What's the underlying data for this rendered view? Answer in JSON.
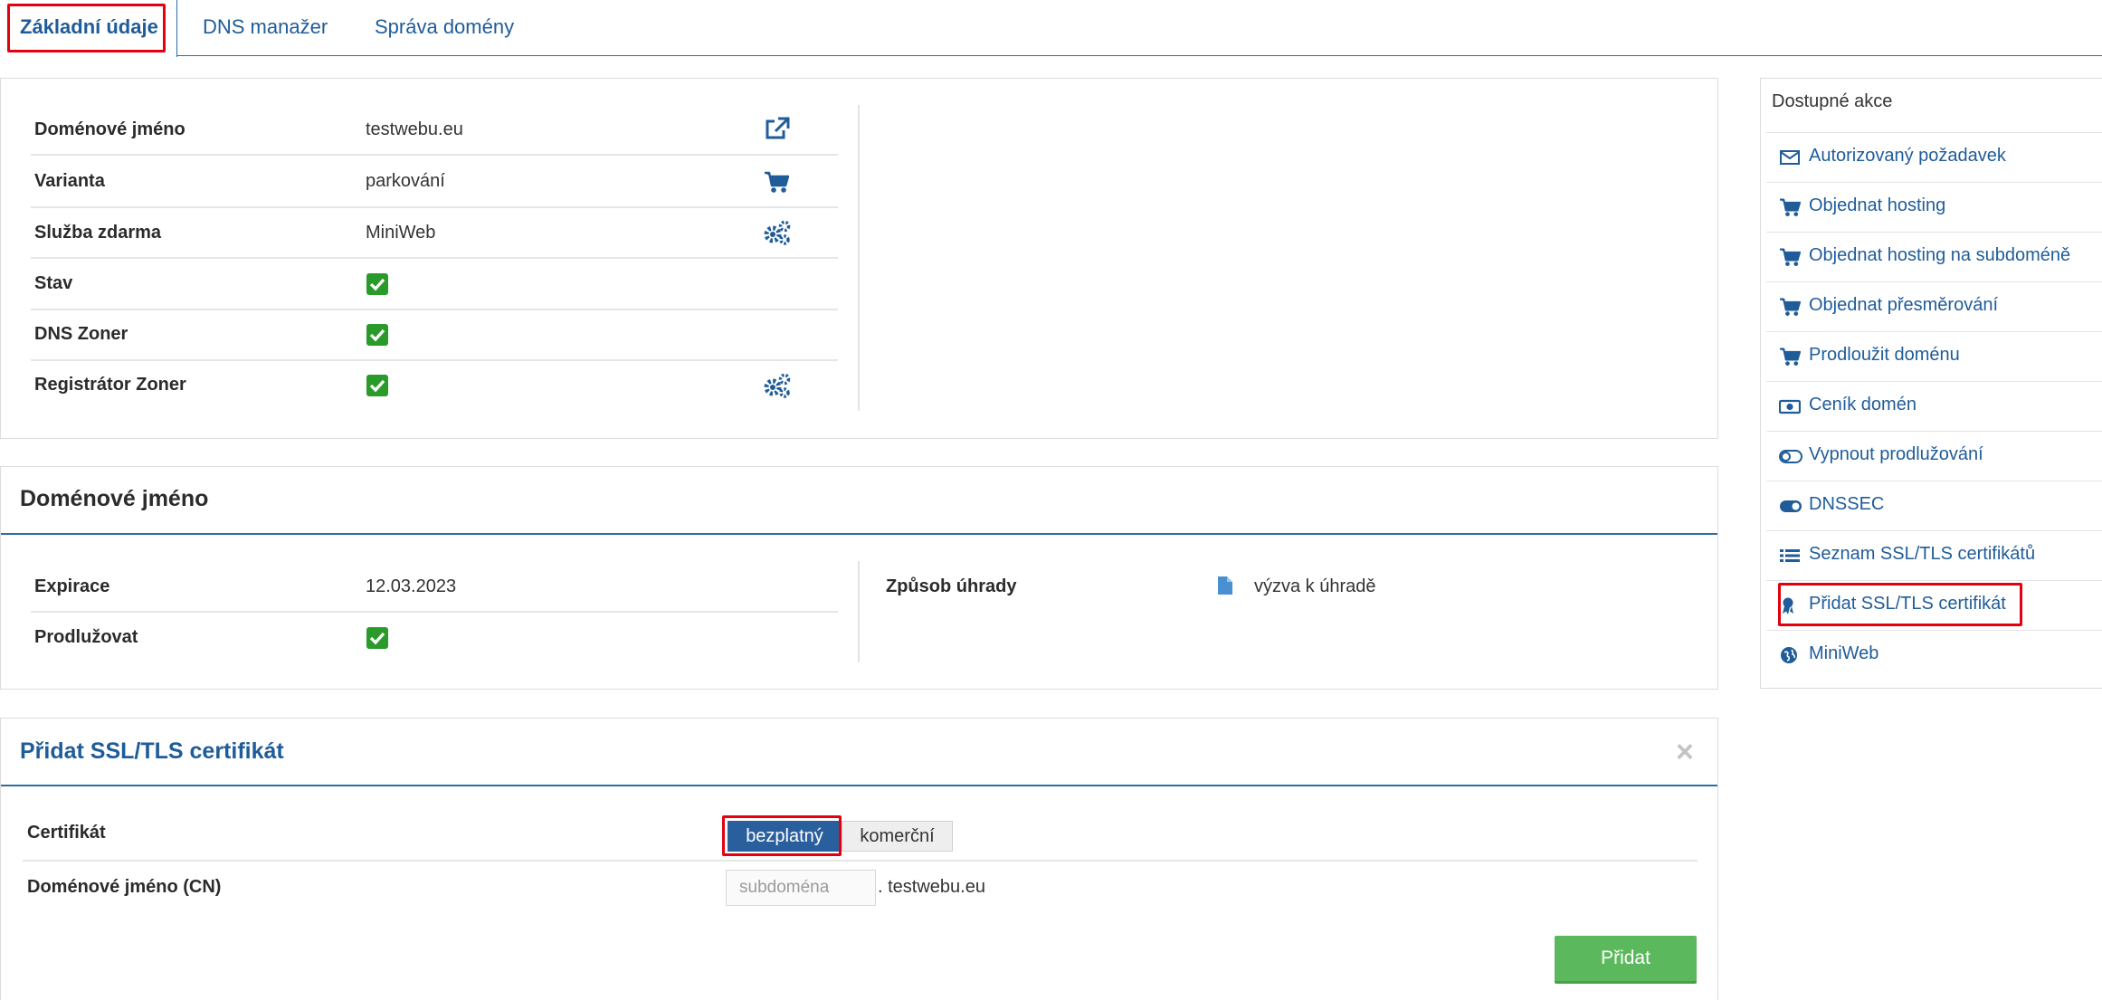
{
  "tabs": [
    {
      "label": "Základní údaje",
      "active": true
    },
    {
      "label": "DNS manažer",
      "active": false
    },
    {
      "label": "Správa domény",
      "active": false
    }
  ],
  "basic": {
    "rows": [
      {
        "label": "Doménové jméno",
        "value": "testwebu.eu",
        "icon": "external-link-icon"
      },
      {
        "label": "Varianta",
        "value": "parkování",
        "icon": "cart-icon"
      },
      {
        "label": "Služba zdarma",
        "value": "MiniWeb",
        "icon": "gears-icon"
      },
      {
        "label": "Stav",
        "value": "",
        "icon": ""
      },
      {
        "label": "DNS Zoner",
        "value": "",
        "icon": ""
      },
      {
        "label": "Registrátor Zoner",
        "value": "",
        "icon": "gears-icon"
      }
    ]
  },
  "domain_panel": {
    "title": "Doménové jméno",
    "expiry_label": "Expirace",
    "expiry_value": "12.03.2023",
    "renew_label": "Prodlužovat",
    "payment_label": "Způsob úhrady",
    "payment_value": "výzva k úhradě"
  },
  "ssl_panel": {
    "title": "Přidat SSL/TLS certifikát",
    "close_symbol": "×",
    "cert_label": "Certifikát",
    "cert_options": [
      "bezplatný",
      "komerční"
    ],
    "cert_selected": "bezplatný",
    "cn_label": "Doménové jméno (CN)",
    "cn_placeholder": "subdoména",
    "cn_suffix": ". testwebu.eu",
    "submit_label": "Přidat"
  },
  "sidebar": {
    "title": "Dostupné akce",
    "items": [
      {
        "label": "Autorizovaný požadavek",
        "icon": "envelope-icon"
      },
      {
        "label": "Objednat hosting",
        "icon": "cart-icon"
      },
      {
        "label": "Objednat hosting na subdoméně",
        "icon": "cart-icon"
      },
      {
        "label": "Objednat přesměrování",
        "icon": "cart-icon"
      },
      {
        "label": "Prodloužit doménu",
        "icon": "cart-icon"
      },
      {
        "label": "Ceník domén",
        "icon": "money-icon"
      },
      {
        "label": "Vypnout prodlužování",
        "icon": "toggle-off-icon"
      },
      {
        "label": "DNSSEC",
        "icon": "toggle-on-icon"
      },
      {
        "label": "Seznam SSL/TLS certifikátů",
        "icon": "list-icon"
      },
      {
        "label": "Přidat SSL/TLS certifikát",
        "icon": "certificate-icon"
      },
      {
        "label": "MiniWeb",
        "icon": "globe-icon"
      }
    ]
  },
  "colors": {
    "link": "#1f5c99",
    "accent_line": "#2e6da4",
    "check": "#2a9b2a",
    "highlight": "#e3000f",
    "submit": "#5cb85c"
  }
}
